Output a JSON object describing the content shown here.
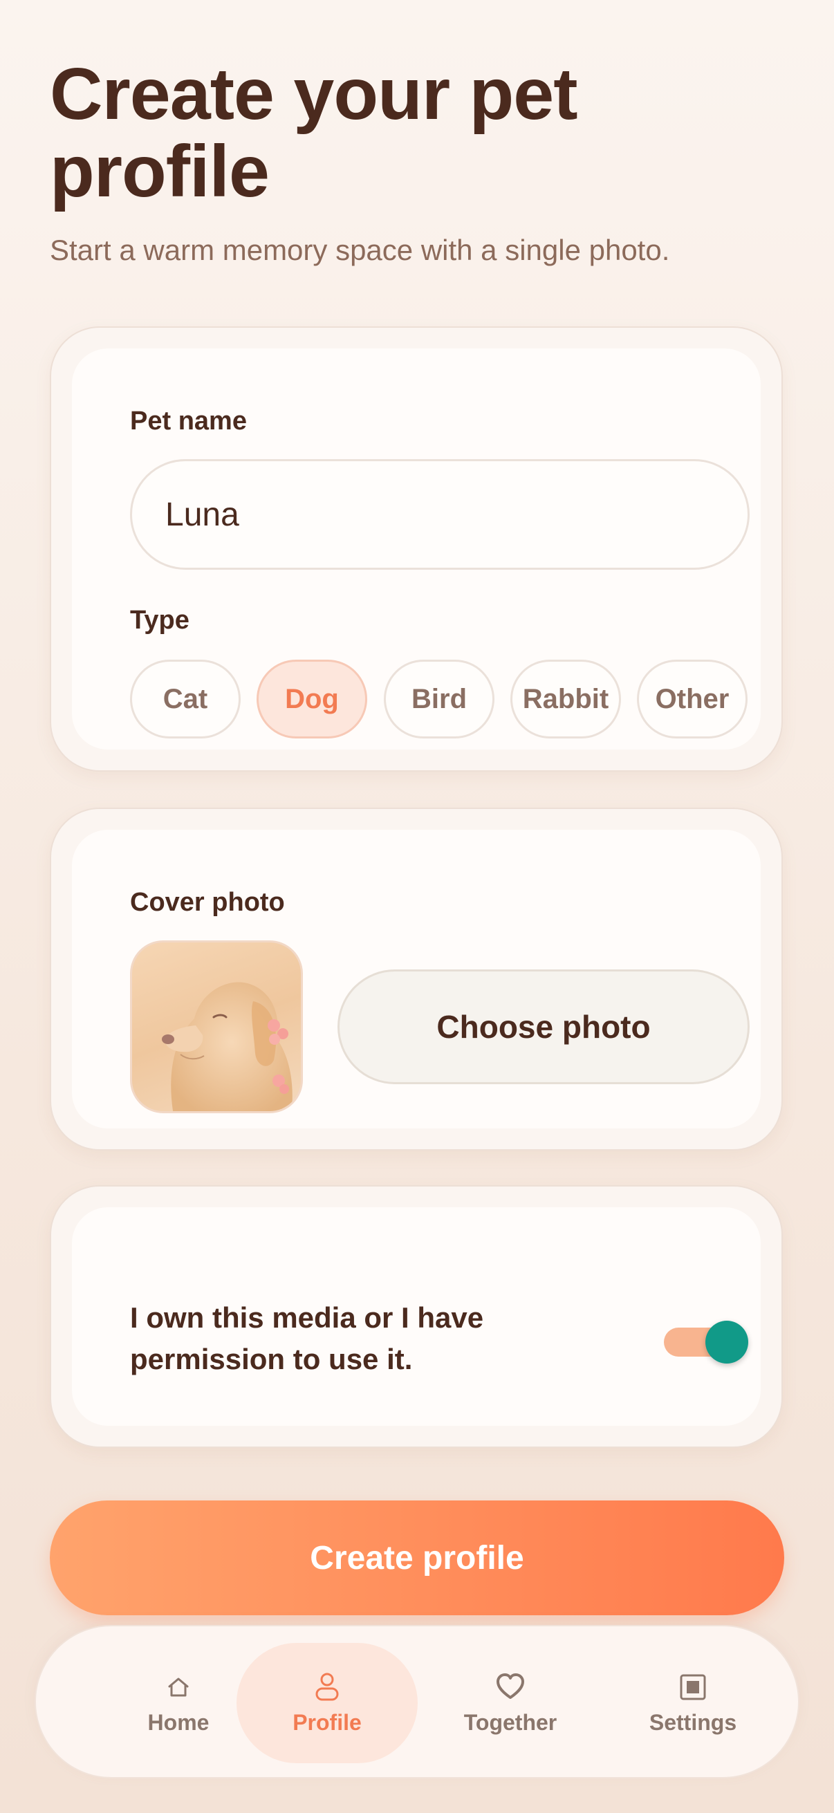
{
  "header": {
    "title": "Create your pet profile",
    "subtitle": "Start a warm memory space with a single photo."
  },
  "pet_form": {
    "name_label": "Pet name",
    "name_value": "Luna",
    "type_label": "Type",
    "types": [
      "Cat",
      "Dog",
      "Bird",
      "Rabbit",
      "Other"
    ],
    "selected_type": "Dog"
  },
  "cover": {
    "label": "Cover photo",
    "choose_label": "Choose photo",
    "thumbnail_icon": "dog-photo-thumbnail"
  },
  "permission": {
    "text": "I own this media or I have permission to use it.",
    "toggle_on": true
  },
  "cta": {
    "label": "Create profile"
  },
  "nav": {
    "items": [
      {
        "label": "Home",
        "icon": "home-icon"
      },
      {
        "label": "Profile",
        "icon": "profile-icon"
      },
      {
        "label": "Together",
        "icon": "heart-icon"
      },
      {
        "label": "Settings",
        "icon": "settings-icon"
      }
    ],
    "active": "Profile"
  },
  "colors": {
    "accent": "#f27b52",
    "cta_start": "#ffa36c",
    "cta_end": "#ff7a4c",
    "toggle_knob": "#119a88",
    "toggle_track": "#f8b48f",
    "text_dark": "#4b2a1e",
    "text_muted": "#8c6a5a"
  }
}
